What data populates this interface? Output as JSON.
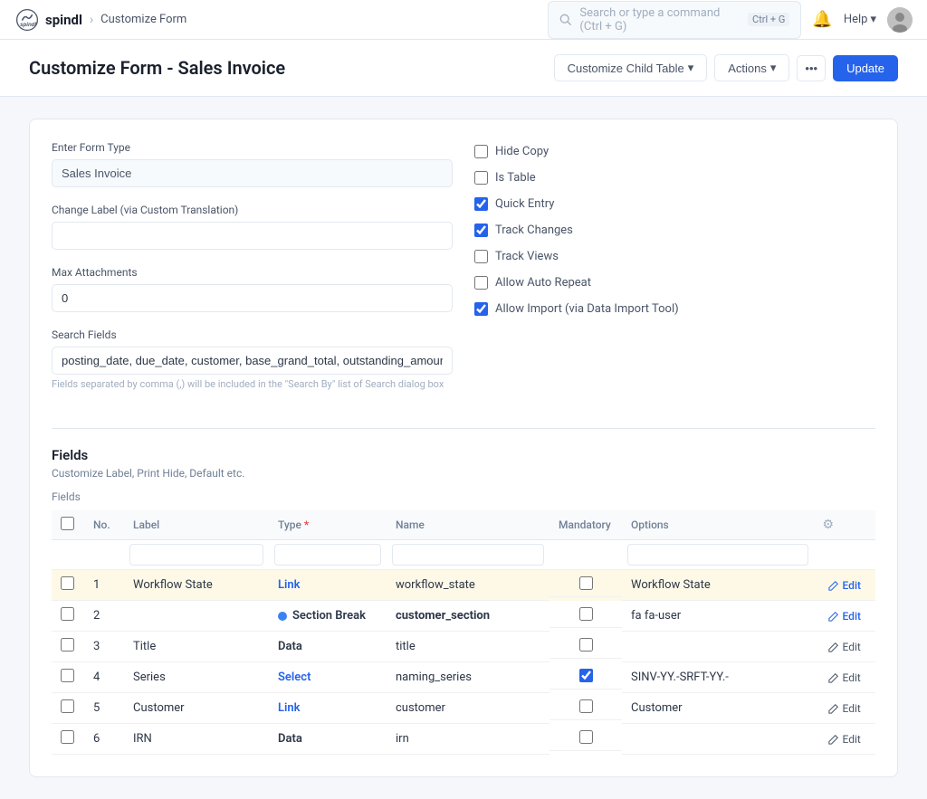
{
  "app": {
    "name": "spindl",
    "logo_alt": "Spindl logo"
  },
  "nav": {
    "breadcrumb": "Customize Form",
    "search_placeholder": "Search or type a command (Ctrl + G)",
    "help_label": "Help"
  },
  "page": {
    "title": "Customize Form - Sales Invoice",
    "customize_child_table_label": "Customize Child Table",
    "actions_label": "Actions",
    "update_label": "Update"
  },
  "form": {
    "enter_form_type_label": "Enter Form Type",
    "enter_form_type_value": "Sales Invoice",
    "change_label_label": "Change Label (via Custom Translation)",
    "change_label_value": "",
    "max_attachments_label": "Max Attachments",
    "max_attachments_value": "0",
    "search_fields_label": "Search Fields",
    "search_fields_value": "posting_date, due_date, customer, base_grand_total, outstanding_amount",
    "search_fields_hint": "Fields separated by comma (,) will be included in the \"Search By\" list of Search dialog box",
    "checkboxes": [
      {
        "id": "hide_copy",
        "label": "Hide Copy",
        "checked": false
      },
      {
        "id": "is_table",
        "label": "Is Table",
        "checked": false
      },
      {
        "id": "quick_entry",
        "label": "Quick Entry",
        "checked": true
      },
      {
        "id": "track_changes",
        "label": "Track Changes",
        "checked": true
      },
      {
        "id": "track_views",
        "label": "Track Views",
        "checked": false
      },
      {
        "id": "allow_auto_repeat",
        "label": "Allow Auto Repeat",
        "checked": false
      },
      {
        "id": "allow_import",
        "label": "Allow Import (via Data Import Tool)",
        "checked": true
      }
    ]
  },
  "fields_section": {
    "title": "Fields",
    "subtitle": "Customize Label, Print Hide, Default etc.",
    "fields_label": "Fields",
    "columns": [
      {
        "key": "checkbox",
        "label": ""
      },
      {
        "key": "no",
        "label": "No."
      },
      {
        "key": "label",
        "label": "Label"
      },
      {
        "key": "type",
        "label": "Type"
      },
      {
        "key": "name",
        "label": "Name"
      },
      {
        "key": "mandatory",
        "label": "Mandatory"
      },
      {
        "key": "options",
        "label": "Options"
      },
      {
        "key": "actions",
        "label": ""
      }
    ],
    "rows": [
      {
        "no": 1,
        "label": "Workflow State",
        "type": "Link",
        "type_class": "type-link",
        "name": "workflow_state",
        "mandatory": false,
        "options": "Workflow State",
        "highlighted": true,
        "edit_highlighted": true
      },
      {
        "no": 2,
        "label": "",
        "type": "Section Break",
        "type_class": "section-break",
        "name": "customer_section",
        "mandatory": false,
        "options": "fa fa-user",
        "highlighted": false,
        "edit_highlighted": true
      },
      {
        "no": 3,
        "label": "Title",
        "type": "Data",
        "type_class": "type-data",
        "name": "title",
        "mandatory": false,
        "options": "",
        "highlighted": false,
        "edit_highlighted": false
      },
      {
        "no": 4,
        "label": "Series",
        "type": "Select",
        "type_class": "type-select",
        "name": "naming_series",
        "mandatory": true,
        "options": "SINV-YY.-SRFT-YY.-",
        "highlighted": false,
        "edit_highlighted": false
      },
      {
        "no": 5,
        "label": "Customer",
        "type": "Link",
        "type_class": "type-link",
        "name": "customer",
        "mandatory": false,
        "options": "Customer",
        "highlighted": false,
        "edit_highlighted": false
      },
      {
        "no": 6,
        "label": "IRN",
        "type": "Data",
        "type_class": "type-data",
        "name": "irn",
        "mandatory": false,
        "options": "",
        "highlighted": false,
        "edit_highlighted": false
      }
    ]
  }
}
